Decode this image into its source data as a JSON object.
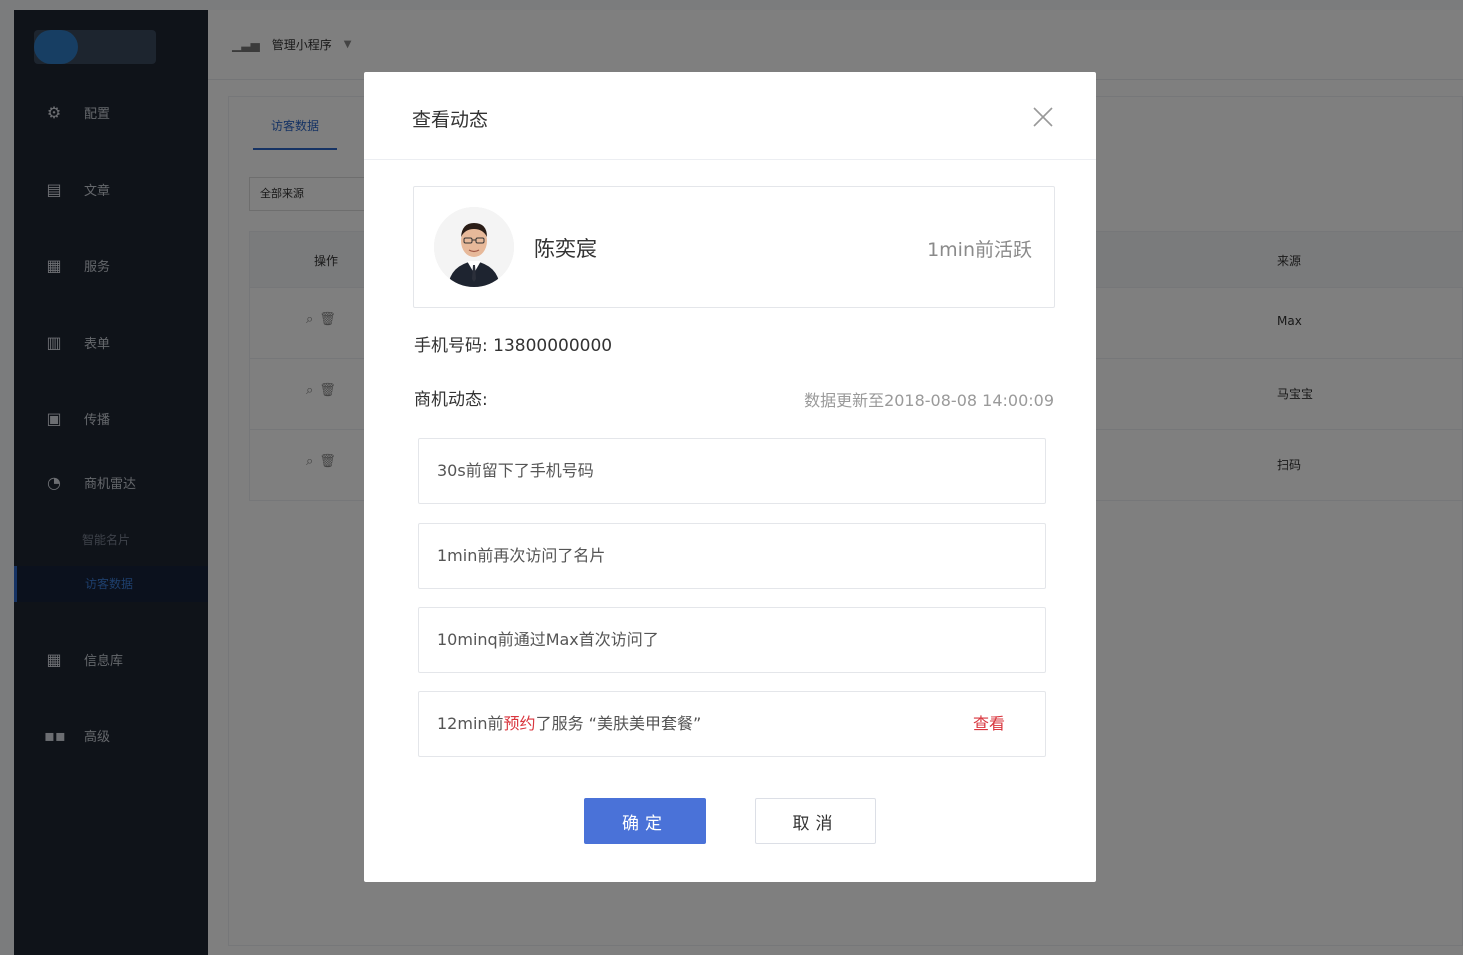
{
  "topbar": {
    "app_switch_label": "管理小程序"
  },
  "sidebar": {
    "items": [
      {
        "label": "配置",
        "icon": "gear-icon"
      },
      {
        "label": "文章",
        "icon": "document-icon"
      },
      {
        "label": "服务",
        "icon": "service-icon"
      },
      {
        "label": "表单",
        "icon": "form-icon"
      },
      {
        "label": "传播",
        "icon": "broadcast-icon"
      },
      {
        "label": "商机雷达",
        "icon": "radar-icon"
      },
      {
        "label": "信息库",
        "icon": "library-icon"
      },
      {
        "label": "高级",
        "icon": "apps-icon"
      }
    ],
    "sub_items": [
      {
        "label": "智能名片"
      },
      {
        "label": "访客数据"
      }
    ]
  },
  "background": {
    "tab_label": "访客数据",
    "filter_label": "全部来源",
    "table_headers": [
      "操作",
      "来源"
    ],
    "rows": [
      {
        "source": "Max"
      },
      {
        "source": "马宝宝"
      },
      {
        "source": "扫码"
      }
    ]
  },
  "modal": {
    "title": "查看动态",
    "profile": {
      "name": "陈奕宸",
      "active_status": "1min前活跃"
    },
    "phone_label": "手机号码:",
    "phone_value": "13800000000",
    "activity_label": "商机动态:",
    "data_updated": "数据更新至2018-08-08 14:00:09",
    "activities": [
      {
        "text": "30s前留下了手机号码"
      },
      {
        "text": "1min前再次访问了名片"
      },
      {
        "text": "10minq前通过Max首次访问了"
      },
      {
        "prefix": "12min前",
        "highlight": "预约",
        "suffix": "了服务 “美肤美甲套餐”",
        "link": "查看"
      }
    ],
    "ok_label": "确定",
    "cancel_label": "取消"
  }
}
